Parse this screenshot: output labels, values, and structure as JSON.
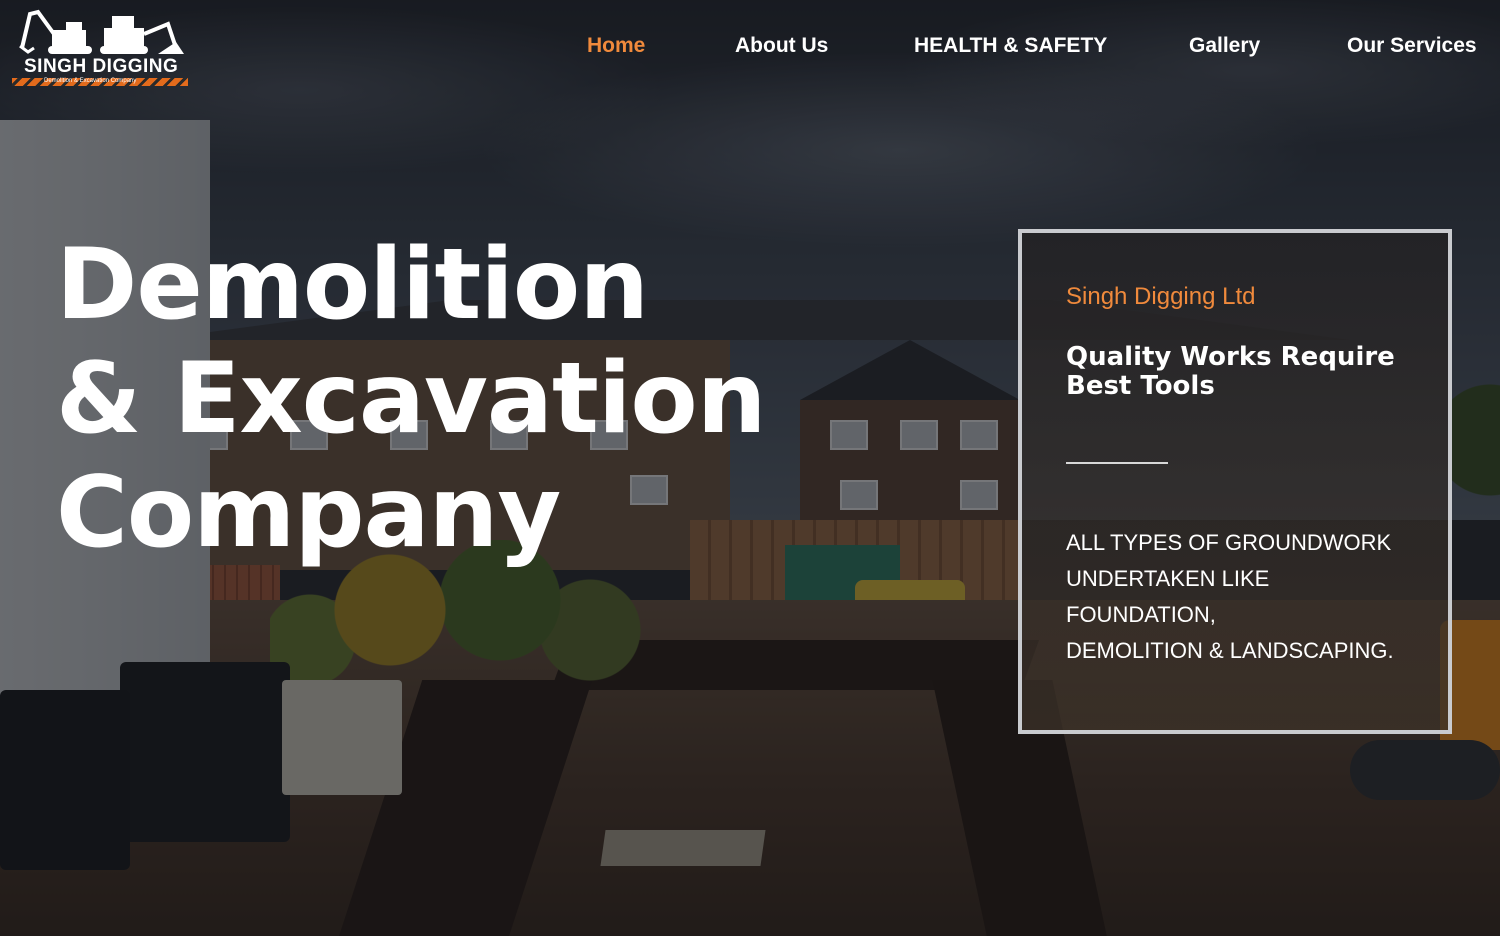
{
  "brand": {
    "logo_text": "SINGH DIGGING",
    "logo_tagline": "Demolition & Excavation Company",
    "accent_color": "#f08a3c"
  },
  "nav": {
    "items": [
      {
        "label": "Home",
        "active": true
      },
      {
        "label": "About Us",
        "active": false
      },
      {
        "label": "HEALTH & SAFETY",
        "active": false
      },
      {
        "label": "Gallery",
        "active": false
      },
      {
        "label": "Our Services",
        "active": false
      }
    ]
  },
  "hero": {
    "title_lines": [
      "Demolition",
      "& Excavation",
      "Company"
    ]
  },
  "card": {
    "kicker": "Singh Digging Ltd",
    "heading": "Quality Works Require Best Tools",
    "body_lines": [
      "ALL TYPES OF GROUNDWORK",
      "UNDERTAKEN LIKE",
      "FOUNDATION,",
      "DEMOLITION & LANDSCAPING."
    ]
  }
}
